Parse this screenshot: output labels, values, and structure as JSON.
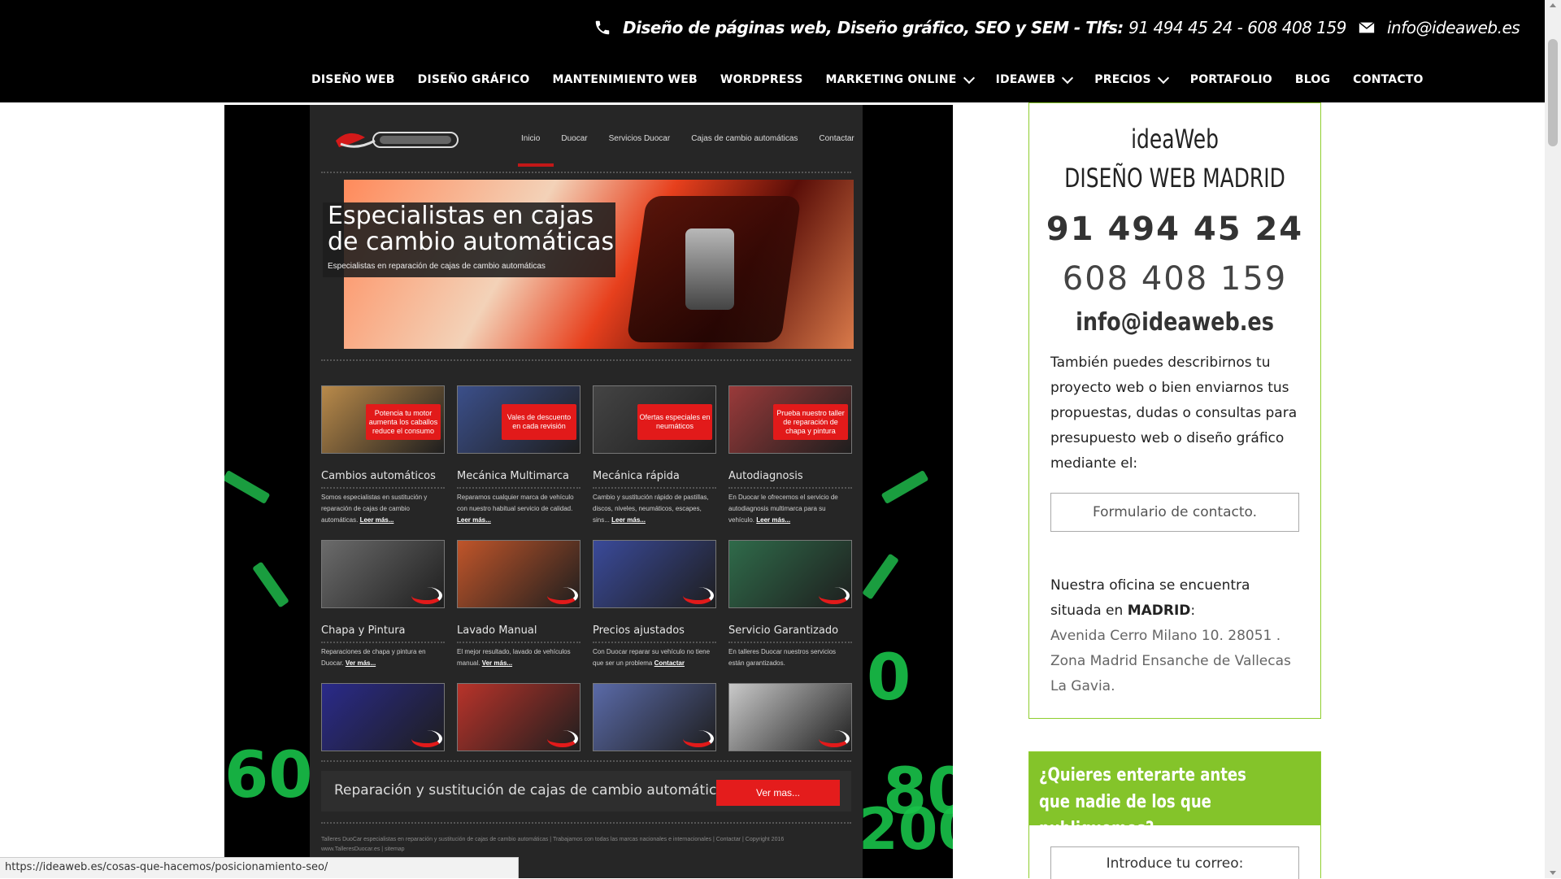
{
  "header": {
    "tagline": "Diseño de páginas web, Diseño gráfico, SEO y SEM - Tlfs:",
    "phones": "91 494 45 24 - 608 408 159",
    "email": "info@ideaweb.es"
  },
  "nav": {
    "items": [
      {
        "label": "DISEÑO WEB",
        "has_dropdown": false
      },
      {
        "label": "DISEÑO GRÁFICO",
        "has_dropdown": false
      },
      {
        "label": "MANTENIMIENTO WEB",
        "has_dropdown": false
      },
      {
        "label": "WORDPRESS",
        "has_dropdown": false
      },
      {
        "label": "MARKETING ONLINE",
        "has_dropdown": true
      },
      {
        "label": "IDEAWEB",
        "has_dropdown": true
      },
      {
        "label": "PRECIOS",
        "has_dropdown": true
      },
      {
        "label": "PORTAFOLIO",
        "has_dropdown": false
      },
      {
        "label": "BLOG",
        "has_dropdown": false
      },
      {
        "label": "CONTACTO",
        "has_dropdown": false
      }
    ]
  },
  "portfolio": {
    "site_nav": [
      "Inicio",
      "Duocar",
      "Servicios Duocar",
      "Cajas de cambio automáticas",
      "Contactar"
    ],
    "hero_title": "Especialistas en cajas de cambio automáticas",
    "hero_subtitle": "Especialistas en reparación de cajas de cambio automáticas",
    "gauge_numbers": [
      "60",
      "80",
      "0",
      "200"
    ],
    "cards": [
      {
        "badge": "Potencia tu motor aumenta los caballos reduce el consumo",
        "title": "Cambios automáticos",
        "text": "Somos especialistas en sustitución y reparación de cajas de cambio automáticas.",
        "more": "Leer más...",
        "bg": "#b98a4a"
      },
      {
        "badge": "Vales de descuento en cada revisión",
        "title": "Mecánica Multimarca",
        "text": "Reparamos cualquier marca de vehículo con nuestro habitual servicio de calidad.",
        "more": "Leer más...",
        "bg": "#3b4f8a"
      },
      {
        "badge": "Ofertas especiales en neumáticos",
        "title": "Mecánica rápida",
        "text": "Cambio y sustitución rápido de pastillas, discos, niveles, neumáticos, escapes, sins...",
        "more": "Leer más...",
        "bg": "#444444"
      },
      {
        "badge": "Prueba nuestro taller de reparación de chapa y pintura",
        "title": "Autodiagnosis",
        "text": "En Duocar le ofrecemos el servicio de autodiagnosis multimarca para su vehículo.",
        "more": "Leer más...",
        "bg": "#9a3a3a"
      },
      {
        "badge": "",
        "title": "Chapa y Pintura",
        "text": "Reparaciones de chapa y pintura en Duocar.",
        "more": "Ver más...",
        "bg": "#6b6b6b"
      },
      {
        "badge": "",
        "title": "Lavado Manual",
        "text": "El mejor resultado, lavado de vehículos manual.",
        "more": "Ver más...",
        "bg": "#c0552a"
      },
      {
        "badge": "",
        "title": "Precios ajustados",
        "text": "Con Duocar reparar su vehículo no tiene que ser un problema",
        "more": "Contactar",
        "bg": "#3a4a9a"
      },
      {
        "badge": "",
        "title": "Servicio Garantizado",
        "text": "En talleres Duocar nuestros servicios están garantizados.",
        "more": "",
        "bg": "#2f6b4a"
      },
      {
        "badge": "",
        "title": "",
        "text": "",
        "more": "",
        "bg": "#2a2a8a"
      },
      {
        "badge": "",
        "title": "",
        "text": "",
        "more": "",
        "bg": "#b8332a"
      },
      {
        "badge": "",
        "title": "",
        "text": "",
        "more": "",
        "bg": "#5a6aa8"
      },
      {
        "badge": "",
        "title": "",
        "text": "",
        "more": "",
        "bg": "#c9c9c9"
      }
    ],
    "banner_text": "Reparación y sustitución de cajas de cambio automáticas.",
    "banner_button": "Ver mas...",
    "footer_text": "Talleres DuoCar especialistas en reparación y sustitución de cajas de cambio automáticas | Trabajamos con todas las marcas nacionales e internacionales | Contactar | Copyright 2016 www.TalleresDuocar.es | sitemap"
  },
  "sidebar": {
    "brand_line1": "ideaWeb",
    "brand_line2": "DISEÑO WEB MADRID",
    "phone1": "91 494 45 24",
    "phone2": "608 408 159",
    "email": "info@ideaweb.es",
    "description": "También puedes describirnos tu proyecto web o bien enviarnos tus propuestas, dudas o consultas para presupuesto web o diseño gráfico mediante el:",
    "contact_button": "Formulario de contacto.",
    "office_intro": "Nuestra oficina se encuentra situada en",
    "office_city": "MADRID",
    "office_colon": ":",
    "office_address": "Avenida Cerro Milano 10. 28051 . Zona Madrid Ensanche de Vallecas La Gavia."
  },
  "newsletter": {
    "title": "¿Quieres enterarte antes que nadie de los que publiquemos?",
    "input_placeholder": "Introduce tu correo:"
  },
  "status_bar": {
    "url": "https://ideaweb.es/cosas-que-hacemos/posicionamiento-seo/"
  },
  "colors": {
    "accent_green": "#84c42a",
    "header_bg": "#000000",
    "portfolio_red": "#e21a1a"
  }
}
